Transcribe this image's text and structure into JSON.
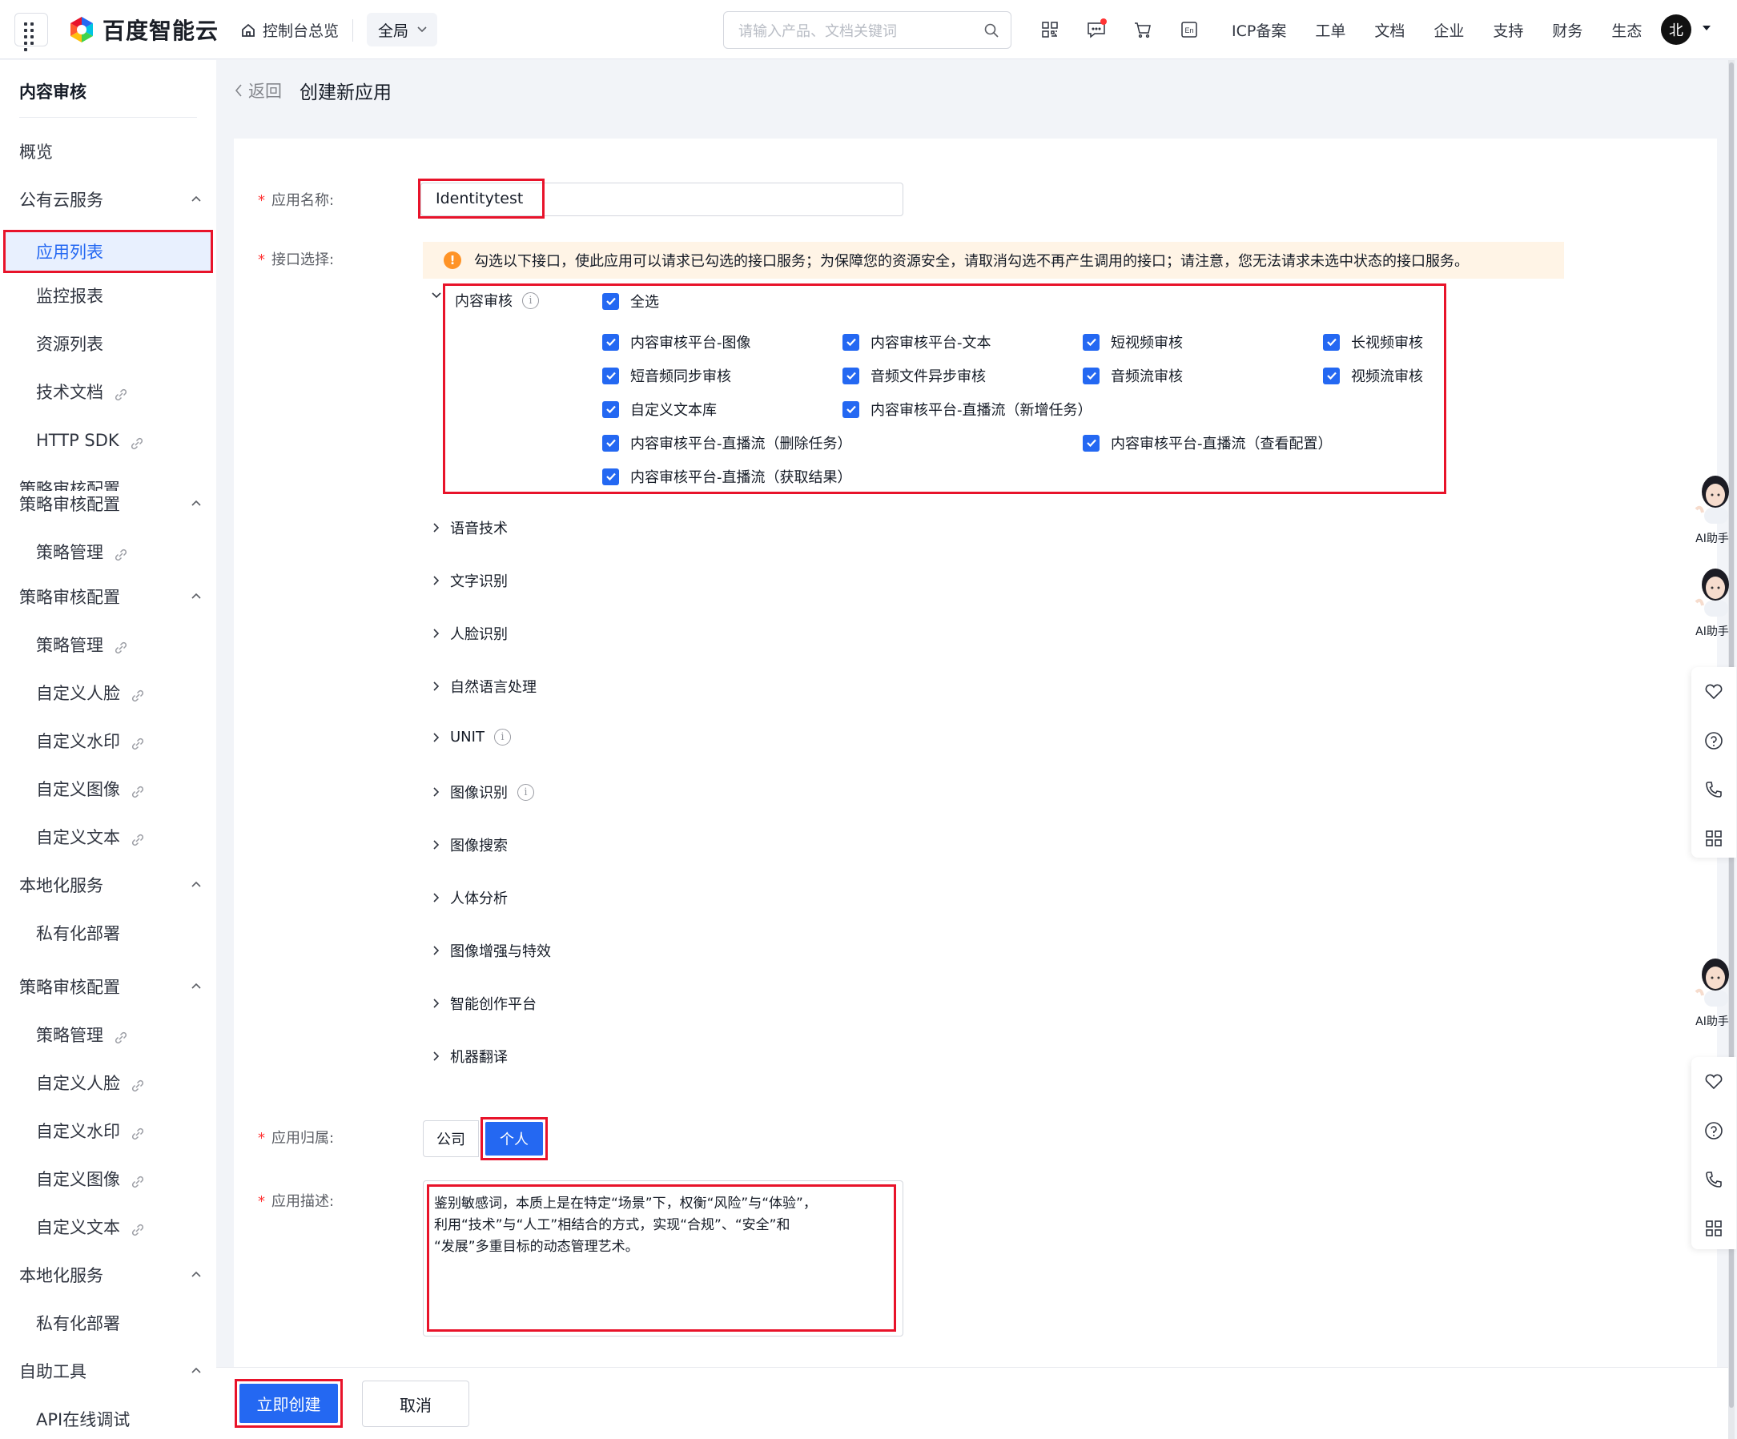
{
  "topbar": {
    "logo_text": "百度智能云",
    "home_label": "控制台总览",
    "scope_label": "全局",
    "search_placeholder": "请输入产品、文档关键词",
    "links": [
      "ICP备案",
      "工单",
      "文档",
      "企业",
      "支持",
      "财务",
      "生态"
    ],
    "avatar_char": "北",
    "icons": [
      "qrcode-icon",
      "message-icon",
      "cart-icon",
      "language-en-icon"
    ]
  },
  "sidebar": {
    "title": "内容审核",
    "items": [
      {
        "label": "概览",
        "level": 1
      },
      {
        "label": "公有云服务",
        "level": 1,
        "expandable": true
      },
      {
        "label": "应用列表",
        "level": 2,
        "active": true
      },
      {
        "label": "监控报表",
        "level": 2
      },
      {
        "label": "资源列表",
        "level": 2
      },
      {
        "label": "技术文档",
        "level": 2,
        "link": true
      },
      {
        "label": "HTTP SDK",
        "level": 2,
        "link": true
      },
      {
        "label": "策略审核配置",
        "level": 1,
        "expandable": true,
        "clipped": true
      },
      {
        "label": "策略审核配置",
        "level": 1,
        "expandable": true
      },
      {
        "label": "策略管理",
        "level": 2,
        "link": true
      },
      {
        "label": "策略审核配置",
        "level": 1,
        "expandable": true
      },
      {
        "label": "策略管理",
        "level": 2,
        "link": true
      },
      {
        "label": "自定义人脸",
        "level": 2,
        "link": true
      },
      {
        "label": "自定义水印",
        "level": 2,
        "link": true
      },
      {
        "label": "自定义图像",
        "level": 2,
        "link": true
      },
      {
        "label": "自定义文本",
        "level": 2,
        "link": true
      },
      {
        "label": "本地化服务",
        "level": 1,
        "expandable": true
      },
      {
        "label": "私有化部署",
        "level": 2
      },
      {
        "label": "策略审核配置",
        "level": 1,
        "expandable": true
      },
      {
        "label": "策略管理",
        "level": 2,
        "link": true
      },
      {
        "label": "自定义人脸",
        "level": 2,
        "link": true
      },
      {
        "label": "自定义水印",
        "level": 2,
        "link": true
      },
      {
        "label": "自定义图像",
        "level": 2,
        "link": true
      },
      {
        "label": "自定义文本",
        "level": 2,
        "link": true
      },
      {
        "label": "本地化服务",
        "level": 1,
        "expandable": true
      },
      {
        "label": "私有化部署",
        "level": 2
      },
      {
        "label": "自助工具",
        "level": 1,
        "expandable": true
      },
      {
        "label": "API在线调试",
        "level": 2
      }
    ]
  },
  "page": {
    "back_label": "返回",
    "title": "创建新应用"
  },
  "form": {
    "name_label": "应用名称:",
    "name_value": "Identitytest",
    "api_label": "接口选择:",
    "notice": "勾选以下接口，使此应用可以请求已勾选的接口服务；为保障您的资源安全，请取消勾选不再产生调用的接口；请注意，您无法请求未选中状态的接口服务。",
    "expanded_group": {
      "name": "内容审核",
      "select_all": "全选",
      "options": [
        "内容审核平台-图像",
        "内容审核平台-文本",
        "短视频审核",
        "长视频审核",
        "短音频同步审核",
        "音频文件异步审核",
        "音频流审核",
        "视频流审核",
        "自定义文本库",
        "内容审核平台-直播流（新增任务）",
        "内容审核平台-直播流（删除任务）",
        "内容审核平台-直播流（查看配置）",
        "内容审核平台-直播流（获取结果）"
      ]
    },
    "collapsed_groups": [
      "语音技术",
      "文字识别",
      "人脸识别",
      "自然语言处理",
      "UNIT",
      "图像识别",
      "图像搜索",
      "人体分析",
      "图像增强与特效",
      "智能创作平台",
      "机器翻译"
    ],
    "owner_label": "应用归属:",
    "owner_options": [
      "公司",
      "个人"
    ],
    "owner_selected": "个人",
    "desc_label": "应用描述:",
    "desc_lines": [
      "鉴别敏感词，本质上是在特定“场景”下，权衡“风险”与“体验”，",
      "利用“技术”与“人工”相结合的方式，实现“合规”、“安全”和",
      "“发展”多重目标的动态管理艺术。"
    ],
    "create_label": "立即创建",
    "cancel_label": "取消"
  },
  "float_tools": {
    "ai_label": "AI助手"
  },
  "colors": {
    "primary": "#2468f2",
    "highlight_border": "#e8132a",
    "notice_bg": "#fff4e6",
    "warning": "#ff9326"
  }
}
